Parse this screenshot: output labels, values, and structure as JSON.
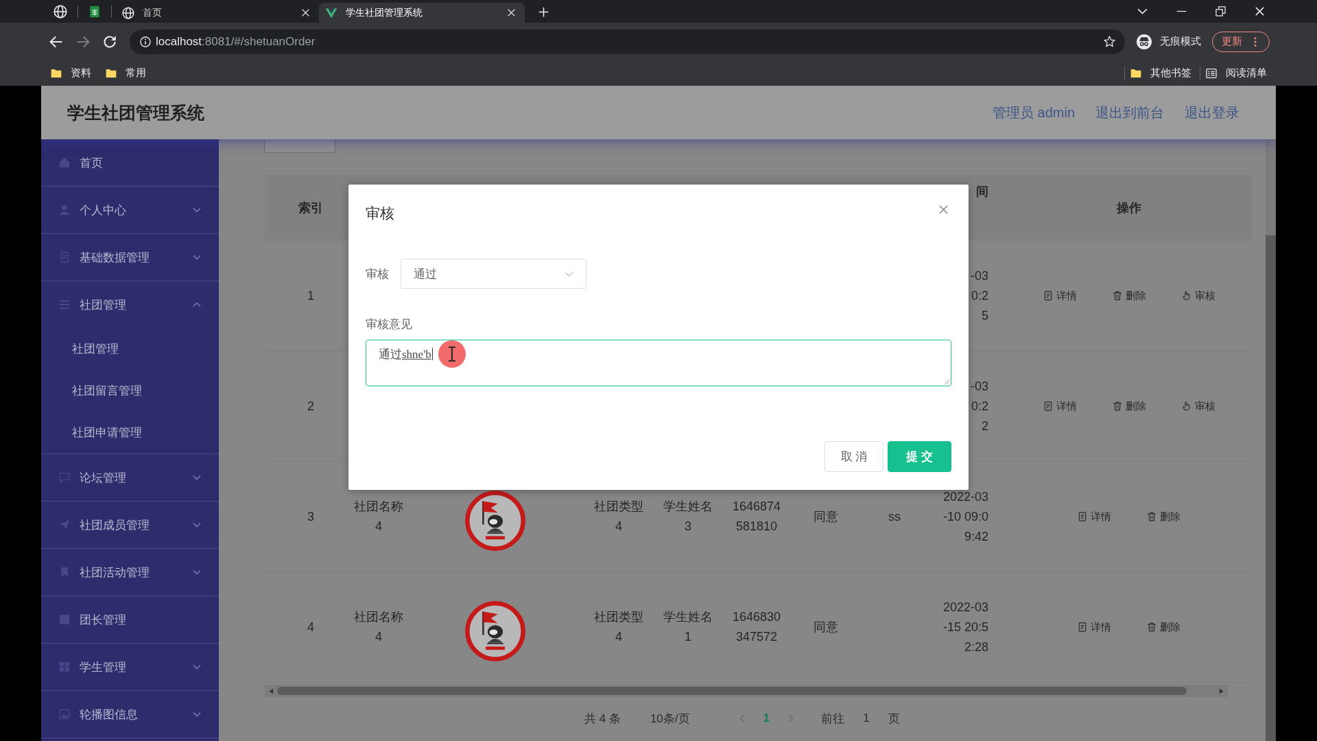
{
  "browser": {
    "tabs": [
      {
        "title": "首页",
        "selected": false
      },
      {
        "title": "学生社团管理系统",
        "selected": true
      }
    ],
    "url": "**localhost**:8081/#/shetuanOrder",
    "profile_label": "无痕模式",
    "update_button": "更新",
    "bookmarks": [
      "资料",
      "常用"
    ],
    "other_bookmarks": "其他书签",
    "reading_list": "阅读清单"
  },
  "header": {
    "title": "学生社团管理系统",
    "links": [
      "管理员 admin",
      "退出到前台",
      "退出登录"
    ]
  },
  "sidebar": [
    {
      "label": "首页",
      "kind": "link"
    },
    {
      "label": "个人中心",
      "kind": "menu",
      "expanded": false
    },
    {
      "label": "基础数据管理",
      "kind": "menu",
      "expanded": false
    },
    {
      "label": "社团管理",
      "kind": "menu",
      "expanded": true,
      "children": [
        {
          "label": "社团管理"
        },
        {
          "label": "社团留言管理"
        },
        {
          "label": "社团申请管理"
        }
      ]
    },
    {
      "label": "论坛管理",
      "kind": "menu",
      "expanded": false
    },
    {
      "label": "社团成员管理",
      "kind": "menu",
      "expanded": false
    },
    {
      "label": "社团活动管理",
      "kind": "menu",
      "expanded": false
    },
    {
      "label": "团长管理",
      "kind": "link"
    },
    {
      "label": "学生管理",
      "kind": "menu",
      "expanded": false
    },
    {
      "label": "轮播图信息",
      "kind": "menu",
      "expanded": false
    }
  ],
  "table": {
    "header": {
      "index": "索引",
      "time": "间",
      "actions": "操作"
    },
    "rows": [
      {
        "index": "1",
        "time": [
          "-03",
          "0:2",
          "5"
        ],
        "actions": [
          {
            "kind": "detail",
            "label": "详情"
          },
          {
            "kind": "delete",
            "label": "删除"
          },
          {
            "kind": "review",
            "label": "审核"
          }
        ]
      },
      {
        "index": "2",
        "time": [
          "-03",
          "0:2",
          "2"
        ],
        "actions": [
          {
            "kind": "detail",
            "label": "详情"
          },
          {
            "kind": "delete",
            "label": "删除"
          },
          {
            "kind": "review",
            "label": "审核"
          }
        ]
      },
      {
        "index": "3",
        "club_name": [
          "社团名称",
          "4"
        ],
        "club_logo": true,
        "club_type": [
          "社团类型",
          "4"
        ],
        "student_name": [
          "学生姓名",
          "3"
        ],
        "phone": [
          "1646874",
          "581810"
        ],
        "status": "同意",
        "comment": "ss",
        "time": [
          "2022-03",
          "-10 09:0",
          "9:42"
        ],
        "actions": [
          {
            "kind": "detail",
            "label": "详情"
          },
          {
            "kind": "delete",
            "label": "删除"
          }
        ]
      },
      {
        "index": "4",
        "club_name": [
          "社团名称",
          "4"
        ],
        "club_logo": true,
        "club_type": [
          "社团类型",
          "4"
        ],
        "student_name": [
          "学生姓名",
          "1"
        ],
        "phone": [
          "1646830",
          "347572"
        ],
        "status": "同意",
        "time": [
          "2022-03",
          "-15 20:5",
          "2:28"
        ],
        "actions": [
          {
            "kind": "detail",
            "label": "详情"
          },
          {
            "kind": "delete",
            "label": "删除"
          }
        ]
      }
    ]
  },
  "pagination": {
    "total": "共 4 条",
    "page_size": "10条/页",
    "pages": [
      {
        "label": "1",
        "selected": true
      }
    ],
    "goto_label": "前往",
    "goto_value": "1",
    "goto_suffix": "页"
  },
  "dialog": {
    "title": "审核",
    "fields": [
      {
        "kind": "select",
        "label": "审核",
        "value": "通过"
      },
      {
        "kind": "textarea",
        "label": "审核意见",
        "value": "通过",
        "composition": "shne'b",
        "focused": true
      }
    ],
    "buttons": [
      {
        "kind": "default",
        "label": "取 消"
      },
      {
        "kind": "primary",
        "label": "提 交"
      }
    ]
  }
}
